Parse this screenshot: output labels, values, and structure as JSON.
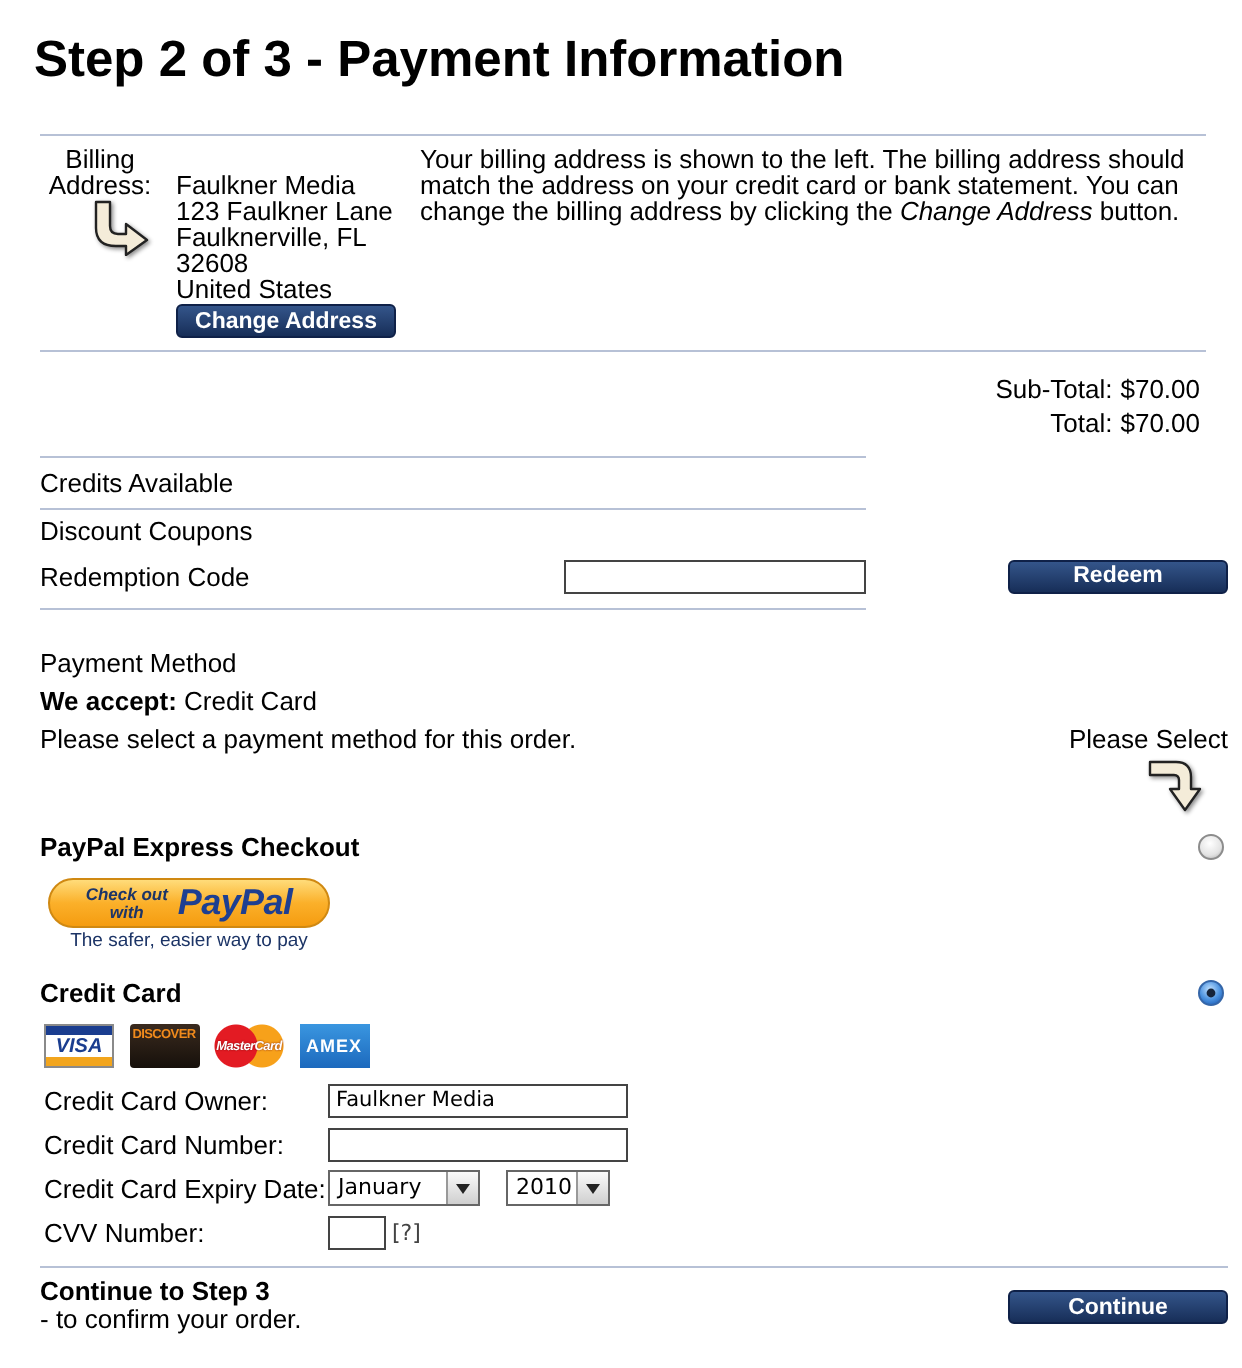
{
  "title": "Step 2 of 3 - Payment Information",
  "billing": {
    "label": "Billing Address:",
    "address_lines": [
      "Faulkner Media",
      "123 Faulkner Lane",
      "Faulknerville, FL",
      "32608",
      "United States"
    ],
    "button": "Change Address",
    "note": "Your billing address is shown to the left. The billing address should match the address on your credit card or bank statement. You can change the billing address by clicking the *Change Address* button."
  },
  "totals": [
    {
      "label": "Sub-Total:",
      "value": "$70.00"
    },
    {
      "label": "Total:",
      "value": "$70.00"
    }
  ],
  "credits": {
    "label": "Credits Available"
  },
  "coupons": {
    "heading": "Discount Coupons",
    "field_label": "Redemption Code",
    "button": "Redeem"
  },
  "payment": {
    "heading": "Payment Method",
    "accepted": "**We accept:** Credit Card",
    "instruction": "Please select a payment method for this order.",
    "hint": "Please Select",
    "methods": [
      {
        "kind": "paypal",
        "title": "PayPal Express Checkout",
        "selected": false,
        "button_lines": [
          "Check out",
          "with"
        ],
        "button_brand": "PayPal",
        "tagline": "The safer, easier way to pay"
      },
      {
        "kind": "card",
        "title": "Credit Card",
        "selected": true,
        "logos": [
          {
            "kind": "visa",
            "text": "VISA"
          },
          {
            "kind": "discover",
            "text": "DISCOVER"
          },
          {
            "kind": "mastercard",
            "text": "MasterCard"
          },
          {
            "kind": "amex",
            "text": "AMEX"
          }
        ],
        "fields": [
          {
            "kind": "text",
            "label": "Credit Card Owner:",
            "value": "Faulkner Media"
          },
          {
            "kind": "text",
            "label": "Credit Card Number:"
          },
          {
            "kind": "expiry",
            "label": "Credit Card Expiry Date:",
            "month": "January",
            "year": "2010"
          },
          {
            "kind": "cvv",
            "label": "CVV Number:",
            "help": "[?]"
          }
        ]
      }
    ]
  },
  "continue": {
    "heading": "Continue to Step 3",
    "subtext": "- to confirm your order.",
    "button": "Continue"
  }
}
